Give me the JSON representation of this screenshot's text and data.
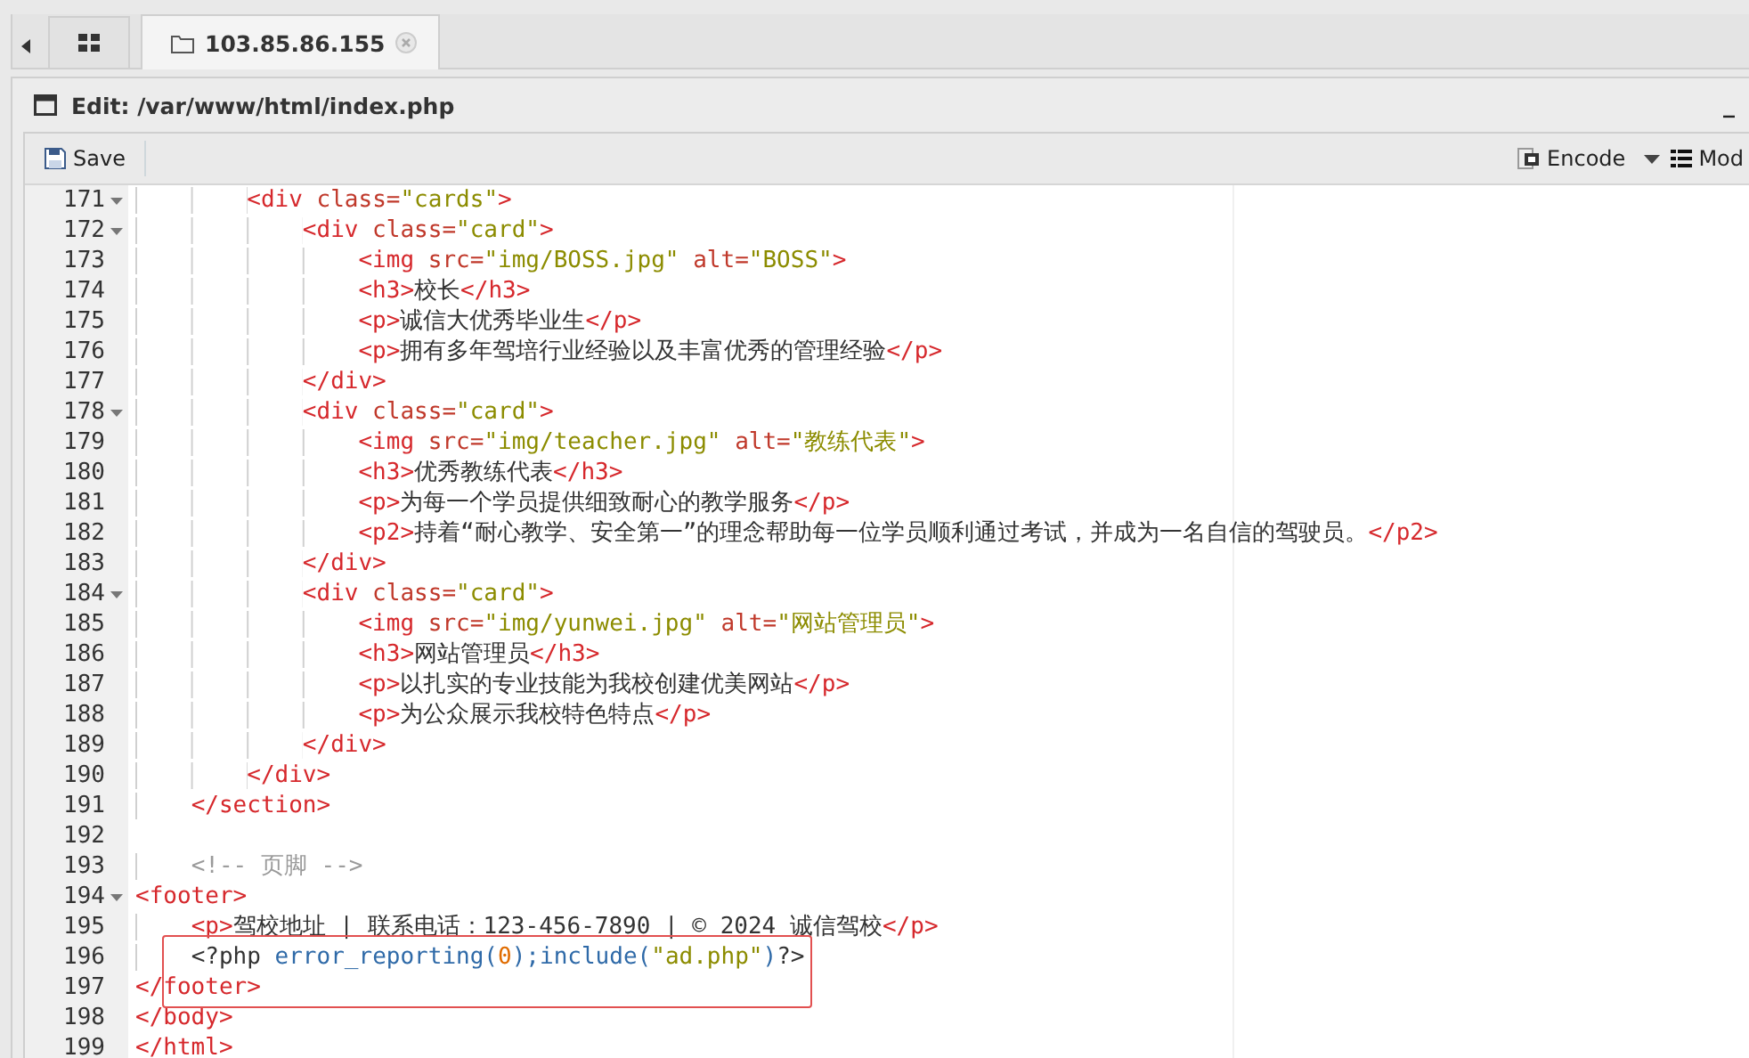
{
  "tabs": [
    {
      "kind": "home",
      "selected": false
    },
    {
      "kind": "folder",
      "label": "103.85.86.155",
      "selected": true
    }
  ],
  "panel": {
    "title": "Edit: /var/www/html/index.php",
    "minimize": "_"
  },
  "toolbar": {
    "save": "Save",
    "encode": "Encode",
    "mode": "Mod"
  },
  "editor": {
    "lines": [
      {
        "number": "171",
        "fold": true,
        "highlighted": false,
        "tokens": [
          {
            "kind": "tag",
            "s": "        <div"
          },
          {
            "kind": "attr",
            "s": " class="
          },
          {
            "kind": "string",
            "s": "\"cards\""
          },
          {
            "kind": "tag",
            "s": ">"
          }
        ]
      },
      {
        "number": "172",
        "fold": true,
        "highlighted": false,
        "tokens": [
          {
            "kind": "tag",
            "s": "            <div"
          },
          {
            "kind": "attr",
            "s": " class="
          },
          {
            "kind": "string",
            "s": "\"card\""
          },
          {
            "kind": "tag",
            "s": ">"
          }
        ]
      },
      {
        "number": "173",
        "fold": false,
        "highlighted": false,
        "tokens": [
          {
            "kind": "tag",
            "s": "                <img"
          },
          {
            "kind": "attr",
            "s": " src="
          },
          {
            "kind": "string",
            "s": "\"img/BOSS.jpg\""
          },
          {
            "kind": "attr",
            "s": " alt="
          },
          {
            "kind": "string",
            "s": "\"BOSS\""
          },
          {
            "kind": "tag",
            "s": ">"
          }
        ]
      },
      {
        "number": "174",
        "fold": false,
        "highlighted": false,
        "tokens": [
          {
            "kind": "tag",
            "s": "                <h3>"
          },
          {
            "kind": "text",
            "s": "校长"
          },
          {
            "kind": "tag",
            "s": "</h3>"
          }
        ]
      },
      {
        "number": "175",
        "fold": false,
        "highlighted": false,
        "tokens": [
          {
            "kind": "tag",
            "s": "                <p>"
          },
          {
            "kind": "text",
            "s": "诚信大优秀毕业生"
          },
          {
            "kind": "tag",
            "s": "</p>"
          }
        ]
      },
      {
        "number": "176",
        "fold": false,
        "highlighted": false,
        "tokens": [
          {
            "kind": "tag",
            "s": "                <p>"
          },
          {
            "kind": "text",
            "s": "拥有多年驾培行业经验以及丰富优秀的管理经验"
          },
          {
            "kind": "tag",
            "s": "</p>"
          }
        ]
      },
      {
        "number": "177",
        "fold": false,
        "highlighted": false,
        "tokens": [
          {
            "kind": "tag",
            "s": "            </div>"
          }
        ]
      },
      {
        "number": "178",
        "fold": true,
        "highlighted": false,
        "tokens": [
          {
            "kind": "tag",
            "s": "            <div"
          },
          {
            "kind": "attr",
            "s": " class="
          },
          {
            "kind": "string",
            "s": "\"card\""
          },
          {
            "kind": "tag",
            "s": ">"
          }
        ]
      },
      {
        "number": "179",
        "fold": false,
        "highlighted": false,
        "tokens": [
          {
            "kind": "tag",
            "s": "                <img"
          },
          {
            "kind": "attr",
            "s": " src="
          },
          {
            "kind": "string",
            "s": "\"img/teacher.jpg\""
          },
          {
            "kind": "attr",
            "s": " alt="
          },
          {
            "kind": "string",
            "s": "\"教练代表\""
          },
          {
            "kind": "tag",
            "s": ">"
          }
        ]
      },
      {
        "number": "180",
        "fold": false,
        "highlighted": false,
        "tokens": [
          {
            "kind": "tag",
            "s": "                <h3>"
          },
          {
            "kind": "text",
            "s": "优秀教练代表"
          },
          {
            "kind": "tag",
            "s": "</h3>"
          }
        ]
      },
      {
        "number": "181",
        "fold": false,
        "highlighted": false,
        "tokens": [
          {
            "kind": "tag",
            "s": "                <p>"
          },
          {
            "kind": "text",
            "s": "为每一个学员提供细致耐心的教学服务"
          },
          {
            "kind": "tag",
            "s": "</p>"
          }
        ]
      },
      {
        "number": "182",
        "fold": false,
        "highlighted": false,
        "tokens": [
          {
            "kind": "tag",
            "s": "                <p2>"
          },
          {
            "kind": "text",
            "s": "持着“耐心教学、安全第一”的理念帮助每一位学员顺利通过考试，并成为一名自信的驾驶员。"
          },
          {
            "kind": "tag",
            "s": "</p2>"
          }
        ]
      },
      {
        "number": "183",
        "fold": false,
        "highlighted": false,
        "tokens": [
          {
            "kind": "tag",
            "s": "            </div>"
          }
        ]
      },
      {
        "number": "184",
        "fold": true,
        "highlighted": false,
        "tokens": [
          {
            "kind": "tag",
            "s": "            <div"
          },
          {
            "kind": "attr",
            "s": " class="
          },
          {
            "kind": "string",
            "s": "\"card\""
          },
          {
            "kind": "tag",
            "s": ">"
          }
        ]
      },
      {
        "number": "185",
        "fold": false,
        "highlighted": false,
        "tokens": [
          {
            "kind": "tag",
            "s": "                <img"
          },
          {
            "kind": "attr",
            "s": " src="
          },
          {
            "kind": "string",
            "s": "\"img/yunwei.jpg\""
          },
          {
            "kind": "attr",
            "s": " alt="
          },
          {
            "kind": "string",
            "s": "\"网站管理员\""
          },
          {
            "kind": "tag",
            "s": ">"
          }
        ]
      },
      {
        "number": "186",
        "fold": false,
        "highlighted": false,
        "tokens": [
          {
            "kind": "tag",
            "s": "                <h3>"
          },
          {
            "kind": "text",
            "s": "网站管理员"
          },
          {
            "kind": "tag",
            "s": "</h3>"
          }
        ]
      },
      {
        "number": "187",
        "fold": false,
        "highlighted": false,
        "tokens": [
          {
            "kind": "tag",
            "s": "                <p>"
          },
          {
            "kind": "text",
            "s": "以扎实的专业技能为我校创建优美网站"
          },
          {
            "kind": "tag",
            "s": "</p>"
          }
        ]
      },
      {
        "number": "188",
        "fold": false,
        "highlighted": false,
        "tokens": [
          {
            "kind": "tag",
            "s": "                <p>"
          },
          {
            "kind": "text",
            "s": "为公众展示我校特色特点"
          },
          {
            "kind": "tag",
            "s": "</p>"
          }
        ]
      },
      {
        "number": "189",
        "fold": false,
        "highlighted": false,
        "tokens": [
          {
            "kind": "tag",
            "s": "            </div>"
          }
        ]
      },
      {
        "number": "190",
        "fold": false,
        "highlighted": false,
        "tokens": [
          {
            "kind": "tag",
            "s": "        </div>"
          }
        ]
      },
      {
        "number": "191",
        "fold": false,
        "highlighted": false,
        "tokens": [
          {
            "kind": "tag",
            "s": "    </section>"
          }
        ]
      },
      {
        "number": "192",
        "fold": false,
        "highlighted": false
      },
      {
        "number": "193",
        "fold": false,
        "highlighted": false,
        "tokens": [
          {
            "kind": "comment",
            "s": "    <!-- 页脚 -->"
          }
        ]
      },
      {
        "number": "194",
        "fold": true,
        "highlighted": false,
        "tokens": [
          {
            "kind": "tag",
            "s": "<footer>"
          }
        ]
      },
      {
        "number": "195",
        "fold": false,
        "highlighted": false,
        "tokens": [
          {
            "kind": "tag",
            "s": "    <p>"
          },
          {
            "kind": "text",
            "s": "驾校地址 | 联系电话：123-456-7890 | © 2024 诚信驾校"
          },
          {
            "kind": "tag",
            "s": "</p>"
          }
        ]
      },
      {
        "number": "196",
        "fold": false,
        "highlighted": true,
        "tokens": [
          {
            "kind": "text",
            "s": "    <?php "
          },
          {
            "kind": "function",
            "s": "error_reporting("
          },
          {
            "kind": "number",
            "s": "0"
          },
          {
            "kind": "function",
            "s": ");include("
          },
          {
            "kind": "string",
            "s": "\"ad.php\""
          },
          {
            "kind": "function",
            "s": ")"
          },
          {
            "kind": "text",
            "s": "?>"
          }
        ]
      },
      {
        "number": "197",
        "fold": false,
        "highlighted": true,
        "tokens": [
          {
            "kind": "tag",
            "s": "</footer>"
          }
        ]
      },
      {
        "number": "198",
        "fold": false,
        "highlighted": false,
        "tokens": [
          {
            "kind": "tag",
            "s": "</body>"
          }
        ]
      },
      {
        "number": "199",
        "fold": false,
        "highlighted": false,
        "tokens": [
          {
            "kind": "tag",
            "s": "</html>"
          }
        ]
      }
    ]
  }
}
